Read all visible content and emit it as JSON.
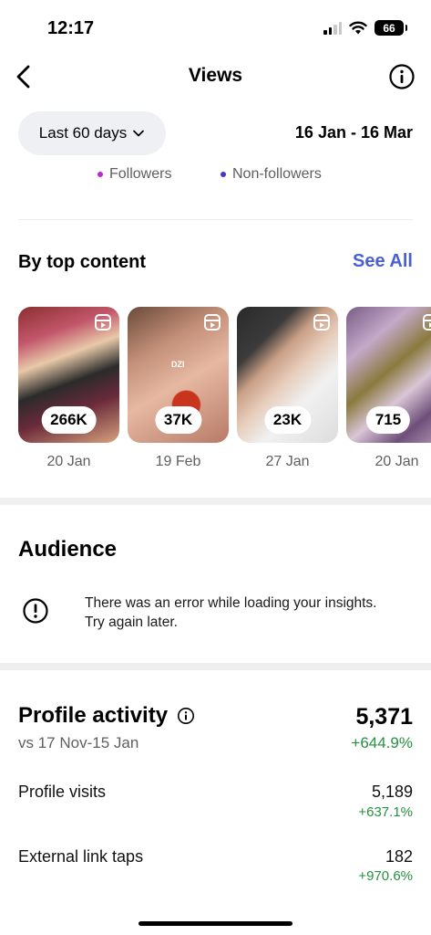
{
  "status_bar": {
    "time": "12:17",
    "battery": "66"
  },
  "nav": {
    "title": "Views",
    "back_icon": "chevron-left-icon",
    "info_icon": "info-icon"
  },
  "filters": {
    "range_label": "Last 60 days",
    "date_range": "16 Jan - 16 Mar"
  },
  "legend": {
    "followers": "Followers",
    "followers_color": "#c026d3",
    "non_followers": "Non-followers",
    "non_followers_color": "#4338ca"
  },
  "top_content": {
    "title": "By top content",
    "see_all": "See All",
    "items": [
      {
        "count": "266K",
        "date": "20 Jan",
        "overlay_text": ""
      },
      {
        "count": "37K",
        "date": "19 Feb",
        "overlay_text": "DZI"
      },
      {
        "count": "23K",
        "date": "27 Jan",
        "overlay_text": ""
      },
      {
        "count": "715",
        "date": "20 Jan",
        "overlay_text": ""
      }
    ]
  },
  "audience": {
    "title": "Audience",
    "error_message": "There was an error while loading your insights. Try again later."
  },
  "profile_activity": {
    "title": "Profile activity",
    "compare_period": "vs 17 Nov-15 Jan",
    "total": "5,371",
    "total_change": "+644.9%",
    "metrics": [
      {
        "label": "Profile visits",
        "value": "5,189",
        "change": "+637.1%"
      },
      {
        "label": "External link taps",
        "value": "182",
        "change": "+970.6%"
      }
    ]
  }
}
